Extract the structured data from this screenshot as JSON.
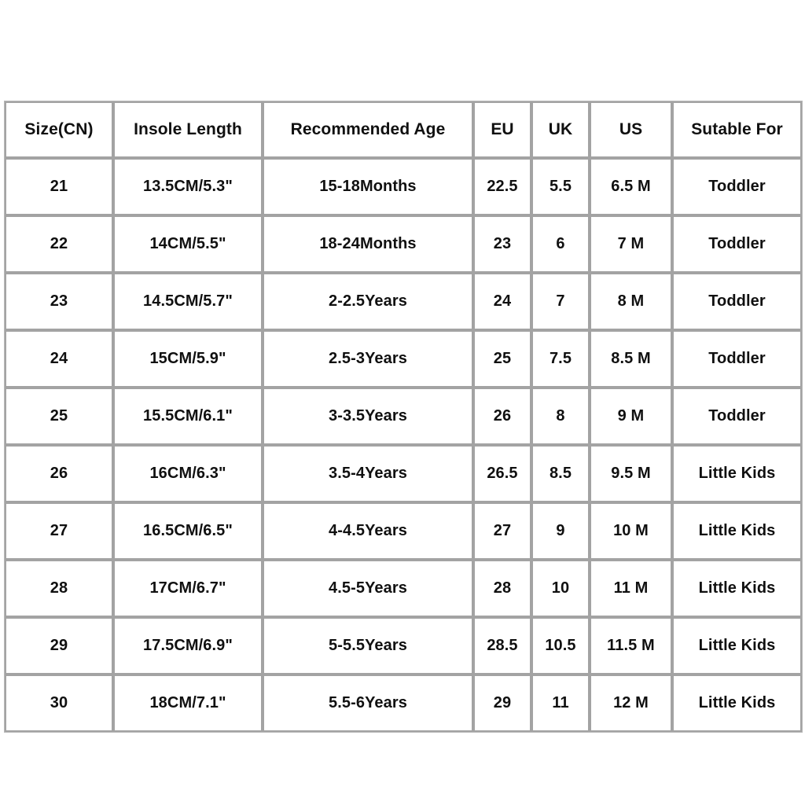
{
  "table": {
    "name": "shoe-size-chart",
    "columns": [
      {
        "key": "size_cn",
        "label": "Size(CN)"
      },
      {
        "key": "insole",
        "label": "Insole Length"
      },
      {
        "key": "age",
        "label": "Recommended Age"
      },
      {
        "key": "eu",
        "label": "EU"
      },
      {
        "key": "uk",
        "label": "UK"
      },
      {
        "key": "us",
        "label": "US"
      },
      {
        "key": "suitable",
        "label": "Sutable For"
      }
    ],
    "rows": [
      {
        "size_cn": "21",
        "insole": "13.5CM/5.3\"",
        "age": "15-18Months",
        "eu": "22.5",
        "uk": "5.5",
        "us": "6.5 M",
        "suitable": "Toddler"
      },
      {
        "size_cn": "22",
        "insole": "14CM/5.5\"",
        "age": "18-24Months",
        "eu": "23",
        "uk": "6",
        "us": "7 M",
        "suitable": "Toddler"
      },
      {
        "size_cn": "23",
        "insole": "14.5CM/5.7\"",
        "age": "2-2.5Years",
        "eu": "24",
        "uk": "7",
        "us": "8 M",
        "suitable": "Toddler"
      },
      {
        "size_cn": "24",
        "insole": "15CM/5.9\"",
        "age": "2.5-3Years",
        "eu": "25",
        "uk": "7.5",
        "us": "8.5 M",
        "suitable": "Toddler"
      },
      {
        "size_cn": "25",
        "insole": "15.5CM/6.1\"",
        "age": "3-3.5Years",
        "eu": "26",
        "uk": "8",
        "us": "9 M",
        "suitable": "Toddler"
      },
      {
        "size_cn": "26",
        "insole": "16CM/6.3\"",
        "age": "3.5-4Years",
        "eu": "26.5",
        "uk": "8.5",
        "us": "9.5 M",
        "suitable": "Little Kids"
      },
      {
        "size_cn": "27",
        "insole": "16.5CM/6.5\"",
        "age": "4-4.5Years",
        "eu": "27",
        "uk": "9",
        "us": "10 M",
        "suitable": "Little Kids"
      },
      {
        "size_cn": "28",
        "insole": "17CM/6.7\"",
        "age": "4.5-5Years",
        "eu": "28",
        "uk": "10",
        "us": "11 M",
        "suitable": "Little Kids"
      },
      {
        "size_cn": "29",
        "insole": "17.5CM/6.9\"",
        "age": "5-5.5Years",
        "eu": "28.5",
        "uk": "10.5",
        "us": "11.5 M",
        "suitable": "Little Kids"
      },
      {
        "size_cn": "30",
        "insole": "18CM/7.1\"",
        "age": "5.5-6Years",
        "eu": "29",
        "uk": "11",
        "us": "12 M",
        "suitable": "Little Kids"
      }
    ]
  },
  "colors": {
    "page_background": "#ffffff",
    "cell_background": "#ffffff",
    "cell_border": "#a3a3a3",
    "outer_border": "#b8b8b8",
    "text": "#101010"
  }
}
